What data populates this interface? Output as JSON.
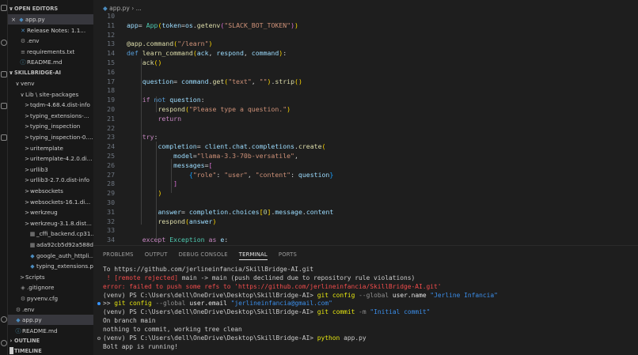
{
  "sidebar": {
    "open_editors_title": "OPEN EDITORS",
    "open_editors": [
      {
        "name": "app.py",
        "icon": "python-icon",
        "close": "×"
      },
      {
        "name": "Release Notes: 1.1...",
        "icon": "vscode-icon"
      },
      {
        "name": ".env",
        "icon": "gear-icon"
      },
      {
        "name": "requirements.txt",
        "icon": "text-file-icon"
      },
      {
        "name": "README.md",
        "icon": "info-icon"
      }
    ],
    "project_title": "SKILLBRIDGE-AI",
    "tree": [
      {
        "name": "venv",
        "chevron": "∨"
      },
      {
        "name": "Lib \\ site-packages",
        "chevron": "∨"
      },
      {
        "name": "tqdm-4.68.4.dist-info",
        "chevron": ">"
      },
      {
        "name": "typing_extensions-...",
        "chevron": ">"
      },
      {
        "name": "typing_inspection",
        "chevron": ">"
      },
      {
        "name": "typing_inspection-0....",
        "chevron": ">"
      },
      {
        "name": "uritemplate",
        "chevron": ">"
      },
      {
        "name": "uritemplate-4.2.0.di...",
        "chevron": ">"
      },
      {
        "name": "urllib3",
        "chevron": ">"
      },
      {
        "name": "urllib3-2.7.0.dist-info",
        "chevron": ">"
      },
      {
        "name": "websockets",
        "chevron": ">"
      },
      {
        "name": "websockets-16.1.di...",
        "chevron": ">"
      },
      {
        "name": "werkzeug",
        "chevron": ">"
      },
      {
        "name": "werkzeug-3.1.8.dist...",
        "chevron": ">"
      },
      {
        "name": "_cffi_backend.cp31...",
        "icon": "binary-file-icon"
      },
      {
        "name": "ada92cb5d92a588d...",
        "icon": "binary-file-icon"
      },
      {
        "name": "google_auth_httpli...",
        "icon": "python-icon"
      },
      {
        "name": "typing_extensions.py",
        "icon": "python-icon"
      },
      {
        "name": "Scripts",
        "chevron": ">"
      },
      {
        "name": ".gitignore",
        "icon": "git-icon"
      },
      {
        "name": "pyvenv.cfg",
        "icon": "gear-icon"
      },
      {
        "name": ".env",
        "icon": "gear-icon"
      },
      {
        "name": "app.py",
        "icon": "python-icon"
      },
      {
        "name": "README.md",
        "icon": "info-icon"
      }
    ],
    "outline_title": "OUTLINE",
    "timeline_title": "TIMELINE"
  },
  "editor": {
    "breadcrumb_file": "app.py",
    "breadcrumb_sep": "›",
    "breadcrumb_more": "...",
    "lines": [
      {
        "n": "10",
        "segs": []
      },
      {
        "n": "11",
        "segs": [
          [
            "k-var",
            "app"
          ],
          [
            "",
            "= "
          ],
          [
            "k-cls",
            "App"
          ],
          [
            "k-p1",
            "("
          ],
          [
            "k-var",
            "token"
          ],
          [
            "",
            "="
          ],
          [
            "k-var",
            "os"
          ],
          [
            "",
            "."
          ],
          [
            "k-fn",
            "getenv"
          ],
          [
            "k-p2",
            "("
          ],
          [
            "k-str",
            "\"SLACK_BOT_TOKEN\""
          ],
          [
            "k-p2",
            ")"
          ],
          [
            "k-p1",
            ")"
          ]
        ]
      },
      {
        "n": "12",
        "segs": []
      },
      {
        "n": "13",
        "segs": [
          [
            "k-fn",
            "@app.command"
          ],
          [
            "k-p1",
            "("
          ],
          [
            "k-str",
            "\"/learn\""
          ],
          [
            "k-p1",
            ")"
          ]
        ]
      },
      {
        "n": "14",
        "segs": [
          [
            "k-kw",
            "def "
          ],
          [
            "k-fn",
            "learn_command"
          ],
          [
            "k-p1",
            "("
          ],
          [
            "k-var",
            "ack"
          ],
          [
            "",
            ", "
          ],
          [
            "k-var",
            "respond"
          ],
          [
            "",
            ", "
          ],
          [
            "k-var",
            "command"
          ],
          [
            "k-p1",
            ")"
          ],
          [
            "",
            ":"
          ]
        ]
      },
      {
        "n": "15",
        "segs": [
          [
            "",
            "    "
          ],
          [
            "k-fn",
            "ack"
          ],
          [
            "k-p1",
            "()"
          ]
        ]
      },
      {
        "n": "16",
        "segs": []
      },
      {
        "n": "17",
        "segs": [
          [
            "",
            "    "
          ],
          [
            "k-var",
            "question"
          ],
          [
            "",
            "",
            " "
          ],
          [
            "",
            "= "
          ],
          [
            "k-var",
            "command"
          ],
          [
            "",
            "."
          ],
          [
            "k-fn",
            "get"
          ],
          [
            "k-p1",
            "("
          ],
          [
            "k-str",
            "\"text\""
          ],
          [
            "",
            ", "
          ],
          [
            "k-str",
            "\"\""
          ],
          [
            "k-p1",
            ")"
          ],
          [
            "",
            "."
          ],
          [
            "k-fn",
            "strip"
          ],
          [
            "k-p1",
            "()"
          ]
        ]
      },
      {
        "n": "18",
        "segs": []
      },
      {
        "n": "19",
        "segs": [
          [
            "",
            "    "
          ],
          [
            "k-ctl",
            "if "
          ],
          [
            "k-kw",
            "not "
          ],
          [
            "k-var",
            "question"
          ],
          [
            "",
            ":"
          ]
        ]
      },
      {
        "n": "20",
        "segs": [
          [
            "",
            "        "
          ],
          [
            "k-fn",
            "respond"
          ],
          [
            "k-p1",
            "("
          ],
          [
            "k-str",
            "\"Please type a question.\""
          ],
          [
            "k-p1",
            ")"
          ]
        ]
      },
      {
        "n": "21",
        "segs": [
          [
            "",
            "        "
          ],
          [
            "k-ctl",
            "return"
          ]
        ]
      },
      {
        "n": "22",
        "segs": []
      },
      {
        "n": "23",
        "segs": [
          [
            "",
            "    "
          ],
          [
            "k-ctl",
            "try"
          ],
          [
            "",
            ":"
          ]
        ]
      },
      {
        "n": "24",
        "segs": [
          [
            "",
            "        "
          ],
          [
            "k-var",
            "completion"
          ],
          [
            "",
            "",
            " "
          ],
          [
            "",
            "= "
          ],
          [
            "k-var",
            "client"
          ],
          [
            "",
            "."
          ],
          [
            "k-var",
            "chat"
          ],
          [
            "",
            "."
          ],
          [
            "k-var",
            "completions"
          ],
          [
            "",
            "."
          ],
          [
            "k-fn",
            "create"
          ],
          [
            "k-p1",
            "("
          ]
        ]
      },
      {
        "n": "25",
        "segs": [
          [
            "",
            "            "
          ],
          [
            "k-var",
            "model"
          ],
          [
            "",
            "="
          ],
          [
            "k-str",
            "\"llama-3.3-70b-versatile\""
          ],
          [
            "",
            ","
          ]
        ]
      },
      {
        "n": "26",
        "segs": [
          [
            "",
            "            "
          ],
          [
            "k-var",
            "messages"
          ],
          [
            "",
            "="
          ],
          [
            "k-p2",
            "["
          ]
        ]
      },
      {
        "n": "27",
        "segs": [
          [
            "",
            "                "
          ],
          [
            "k-p3",
            "{"
          ],
          [
            "k-str",
            "\"role\""
          ],
          [
            "",
            ": "
          ],
          [
            "k-str",
            "\"user\""
          ],
          [
            "",
            ", "
          ],
          [
            "k-str",
            "\"content\""
          ],
          [
            "",
            ": "
          ],
          [
            "k-var",
            "question"
          ],
          [
            "k-p3",
            "}"
          ]
        ]
      },
      {
        "n": "28",
        "segs": [
          [
            "",
            "            "
          ],
          [
            "k-p2",
            "]"
          ]
        ]
      },
      {
        "n": "29",
        "segs": [
          [
            "",
            "        "
          ],
          [
            "k-p1",
            ")"
          ]
        ]
      },
      {
        "n": "30",
        "segs": []
      },
      {
        "n": "31",
        "segs": [
          [
            "",
            "        "
          ],
          [
            "k-var",
            "answer"
          ],
          [
            "",
            "",
            " "
          ],
          [
            "",
            "= "
          ],
          [
            "k-var",
            "completion"
          ],
          [
            "",
            "."
          ],
          [
            "k-var",
            "choices"
          ],
          [
            "k-p1",
            "["
          ],
          [
            "k-num",
            "0"
          ],
          [
            "k-p1",
            "]"
          ],
          [
            "",
            "."
          ],
          [
            "k-var",
            "message"
          ],
          [
            "",
            "."
          ],
          [
            "k-var",
            "content"
          ]
        ]
      },
      {
        "n": "32",
        "segs": [
          [
            "",
            "        "
          ],
          [
            "k-fn",
            "respond"
          ],
          [
            "k-p1",
            "("
          ],
          [
            "k-var",
            "answer"
          ],
          [
            "k-p1",
            ")"
          ]
        ]
      },
      {
        "n": "33",
        "segs": []
      },
      {
        "n": "34",
        "segs": [
          [
            "",
            "    "
          ],
          [
            "k-ctl",
            "except "
          ],
          [
            "k-cls",
            "Exception "
          ],
          [
            "k-ctl",
            "as "
          ],
          [
            "k-var",
            "e"
          ],
          [
            "",
            ":"
          ]
        ]
      }
    ]
  },
  "panel": {
    "tabs": [
      "PROBLEMS",
      "OUTPUT",
      "DEBUG CONSOLE",
      "TERMINAL",
      "PORTS"
    ],
    "active_tab": "TERMINAL",
    "terminal_lines": [
      {
        "dot": "",
        "segs": [
          [
            "",
            "To https://github.com/jerlineinfancia/SkillBridge-AI.git"
          ]
        ]
      },
      {
        "dot": "",
        "segs": [
          [
            "t-err",
            " ! [remote rejected] "
          ],
          [
            "",
            "main -> main (push declined due to repository rule violations)"
          ]
        ]
      },
      {
        "dot": "",
        "segs": [
          [
            "t-err",
            "error: failed to push some refs to 'https://github.com/jerlineinfancia/SkillBridge-AI.git'"
          ]
        ]
      },
      {
        "dot": "",
        "segs": [
          [
            "",
            "(venv) PS C:\\Users\\dell\\OneDrive\\Desktop\\SkillBridge-AI> "
          ],
          [
            "t-yellow",
            "git "
          ],
          [
            "t-yellow",
            "config "
          ],
          [
            "t-gray",
            "--global "
          ],
          [
            "t-white",
            "user.name "
          ],
          [
            "t-str",
            "\"Jerline Infancia\""
          ]
        ]
      },
      {
        "dot": "blue",
        "segs": [
          [
            "",
            ">> "
          ],
          [
            "t-yellow",
            "git "
          ],
          [
            "t-yellow",
            "config "
          ],
          [
            "t-gray",
            "--global "
          ],
          [
            "t-white",
            "user.email "
          ],
          [
            "t-str",
            "\"jerlineinfancia@gmail.com\""
          ]
        ]
      },
      {
        "dot": "",
        "segs": [
          [
            "",
            "(venv) PS C:\\Users\\dell\\OneDrive\\Desktop\\SkillBridge-AI> "
          ],
          [
            "t-yellow",
            "git "
          ],
          [
            "t-yellow",
            "commit "
          ],
          [
            "t-gray",
            "-m "
          ],
          [
            "t-str",
            "\"Initial commit\""
          ]
        ]
      },
      {
        "dot": "",
        "segs": [
          [
            "",
            "On branch main"
          ]
        ]
      },
      {
        "dot": "",
        "segs": [
          [
            "",
            "nothing to commit, working tree clean"
          ]
        ]
      },
      {
        "dot": "hollow",
        "segs": [
          [
            "",
            "(venv) PS C:\\Users\\dell\\OneDrive\\Desktop\\SkillBridge-AI> "
          ],
          [
            "t-yellow",
            "python "
          ],
          [
            "",
            "app.py"
          ]
        ]
      },
      {
        "dot": "",
        "segs": [
          [
            "",
            "Bolt app is running!"
          ]
        ]
      }
    ]
  }
}
